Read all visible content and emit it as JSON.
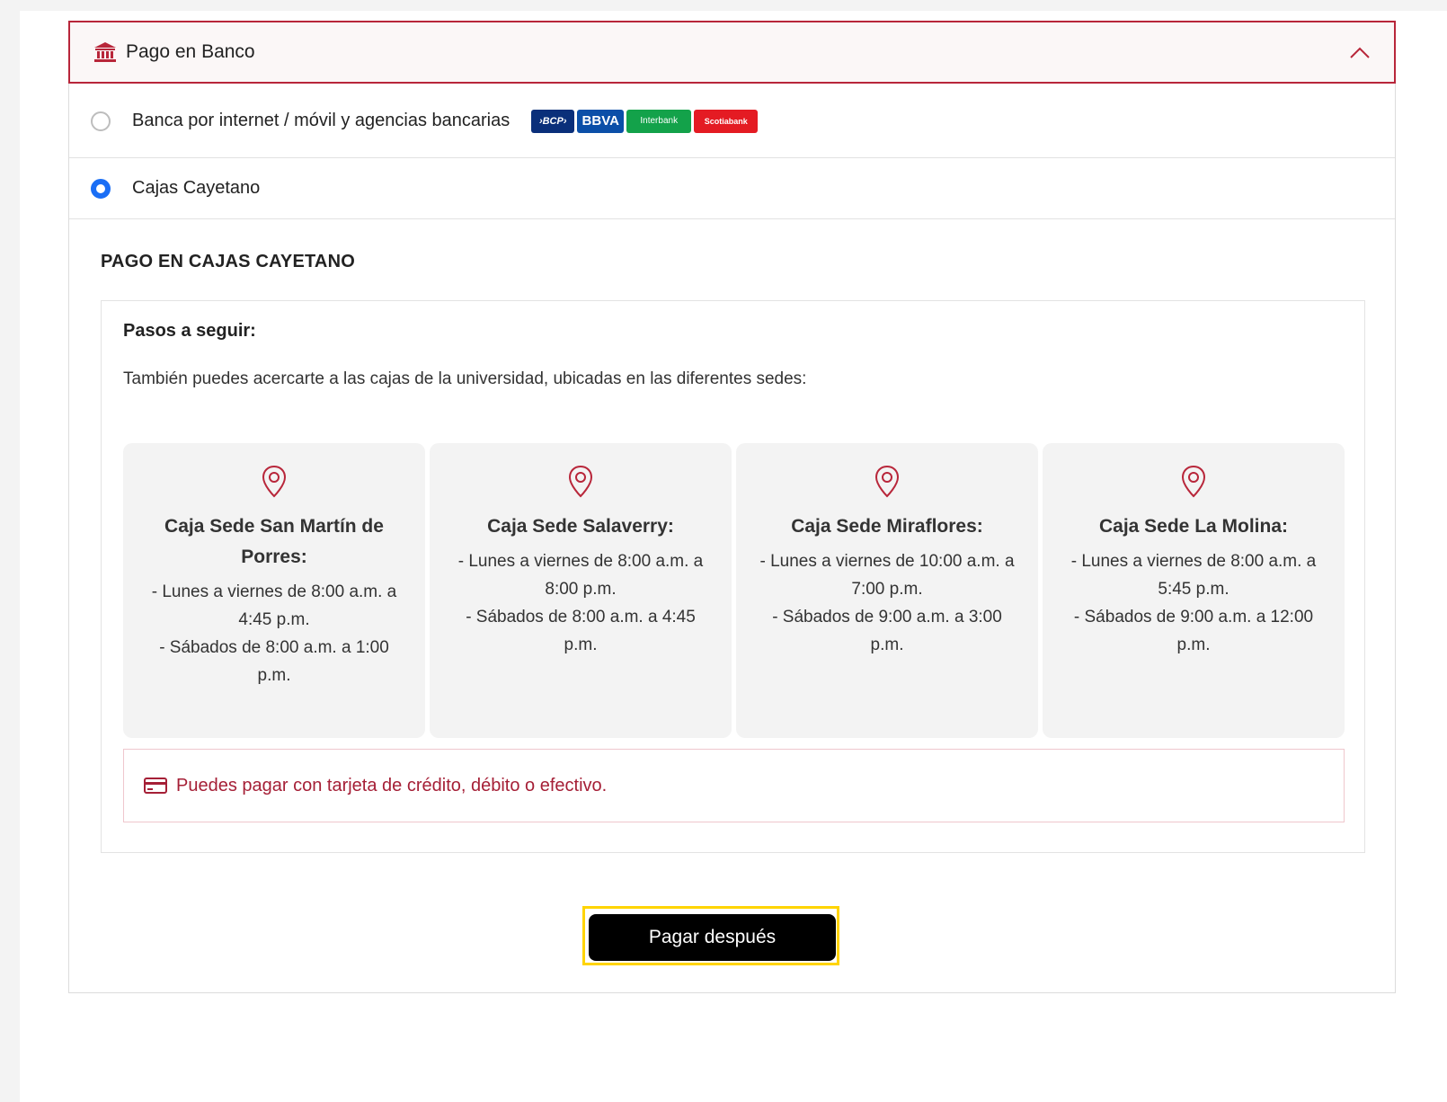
{
  "header": {
    "title": "Pago en Banco"
  },
  "options": [
    {
      "label": "Banca por internet / móvil y agencias bancarias",
      "selected": false
    },
    {
      "label": "Cajas Cayetano",
      "selected": true
    }
  ],
  "bank_logos": [
    {
      "text": "›BCP›",
      "color": "#0a2f7a"
    },
    {
      "text": "BBVA",
      "color": "#0b4fa8"
    },
    {
      "text": "Interbank",
      "color": "#13a24a"
    },
    {
      "text": "Scotiabank",
      "color": "#e41b23"
    }
  ],
  "section_title": "PAGO EN CAJAS CAYETANO",
  "steps": {
    "title": "Pasos a seguir:",
    "description": "También puedes acercarte a las cajas de la universidad, ubicadas en las diferentes sedes:"
  },
  "locations": [
    {
      "name": "Caja Sede San Martín de Porres:",
      "weekday": "- Lunes a viernes de 8:00 a.m. a 4:45 p.m.",
      "saturday": "- Sábados de 8:00 a.m. a 1:00 p.m."
    },
    {
      "name": "Caja Sede Salaverry:",
      "weekday": "- Lunes a viernes de 8:00 a.m. a 8:00 p.m.",
      "saturday": "- Sábados de 8:00 a.m. a 4:45 p.m."
    },
    {
      "name": "Caja Sede Miraflores:",
      "weekday": "- Lunes a viernes de 10:00 a.m. a 7:00 p.m.",
      "saturday": "- Sábados de 9:00 a.m. a 3:00 p.m."
    },
    {
      "name": "Caja Sede La Molina:",
      "weekday": "- Lunes a viernes de 8:00 a.m. a 5:45 p.m.",
      "saturday": "- Sábados de 9:00 a.m. a 12:00 p.m."
    }
  ],
  "notice": "Puedes pagar con tarjeta de crédito, débito o efectivo.",
  "pay_button": "Pagar después",
  "colors": {
    "accent": "#b8263a",
    "radio_selected": "#1a6ef5",
    "highlight": "#ffd400"
  }
}
